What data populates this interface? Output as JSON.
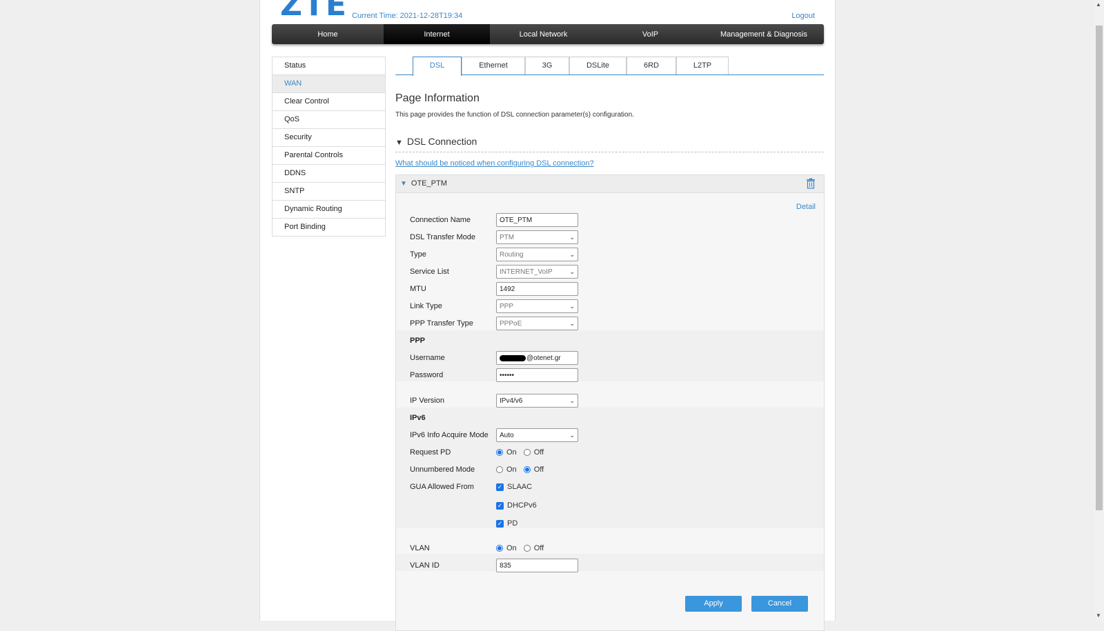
{
  "header": {
    "logo": "ZTE",
    "current_time": "Current Time: 2021-12-28T19:34",
    "logout": "Logout"
  },
  "nav": [
    {
      "label": "Home",
      "active": false
    },
    {
      "label": "Internet",
      "active": true
    },
    {
      "label": "Local Network",
      "active": false
    },
    {
      "label": "VoIP",
      "active": false
    },
    {
      "label": "Management & Diagnosis",
      "active": false
    }
  ],
  "sidebar": [
    {
      "label": "Status"
    },
    {
      "label": "WAN"
    },
    {
      "label": "Clear Control"
    },
    {
      "label": "QoS"
    },
    {
      "label": "Security"
    },
    {
      "label": "Parental Controls"
    },
    {
      "label": "DDNS"
    },
    {
      "label": "SNTP"
    },
    {
      "label": "Dynamic Routing"
    },
    {
      "label": "Port Binding"
    }
  ],
  "tabs": [
    {
      "label": "DSL"
    },
    {
      "label": "Ethernet"
    },
    {
      "label": "3G"
    },
    {
      "label": "DSLite"
    },
    {
      "label": "6RD"
    },
    {
      "label": "L2TP"
    }
  ],
  "page": {
    "title": "Page Information",
    "description": "This page provides the function of DSL connection parameter(s) configuration.",
    "section_title": "DSL Connection",
    "help_link": "What should be noticed when configuring DSL connection?"
  },
  "connection": {
    "name": "OTE_PTM",
    "detail": "Detail",
    "fields": {
      "connection_name": {
        "label": "Connection Name",
        "value": "OTE_PTM"
      },
      "transfer_mode": {
        "label": "DSL Transfer Mode",
        "value": "PTM"
      },
      "type": {
        "label": "Type",
        "value": "Routing"
      },
      "service_list": {
        "label": "Service List",
        "value": "INTERNET_VoIP"
      },
      "mtu": {
        "label": "MTU",
        "value": "1492"
      },
      "link_type": {
        "label": "Link Type",
        "value": "PPP"
      },
      "ppp_transfer_type": {
        "label": "PPP Transfer Type",
        "value": "PPPoE"
      },
      "ppp_header": "PPP",
      "username": {
        "label": "Username",
        "value": "@otenet.gr"
      },
      "password": {
        "label": "Password",
        "value": "••••••"
      },
      "ip_version": {
        "label": "IP Version",
        "value": "IPv4/v6"
      },
      "ipv6_header": "IPv6",
      "ipv6_mode": {
        "label": "IPv6 Info Acquire Mode",
        "value": "Auto"
      },
      "request_pd": {
        "label": "Request PD",
        "on": "On",
        "off": "Off"
      },
      "unnumbered": {
        "label": "Unnumbered Mode",
        "on": "On",
        "off": "Off"
      },
      "gua": {
        "label": "GUA Allowed From",
        "opt1": "SLAAC",
        "opt2": "DHCPv6",
        "opt3": "PD"
      },
      "vlan": {
        "label": "VLAN",
        "on": "On",
        "off": "Off"
      },
      "vlan_id": {
        "label": "VLAN ID",
        "value": "835"
      }
    },
    "apply": "Apply",
    "cancel": "Cancel"
  },
  "colors": {
    "accent": "#3a86c8",
    "button": "#3a96dd"
  }
}
